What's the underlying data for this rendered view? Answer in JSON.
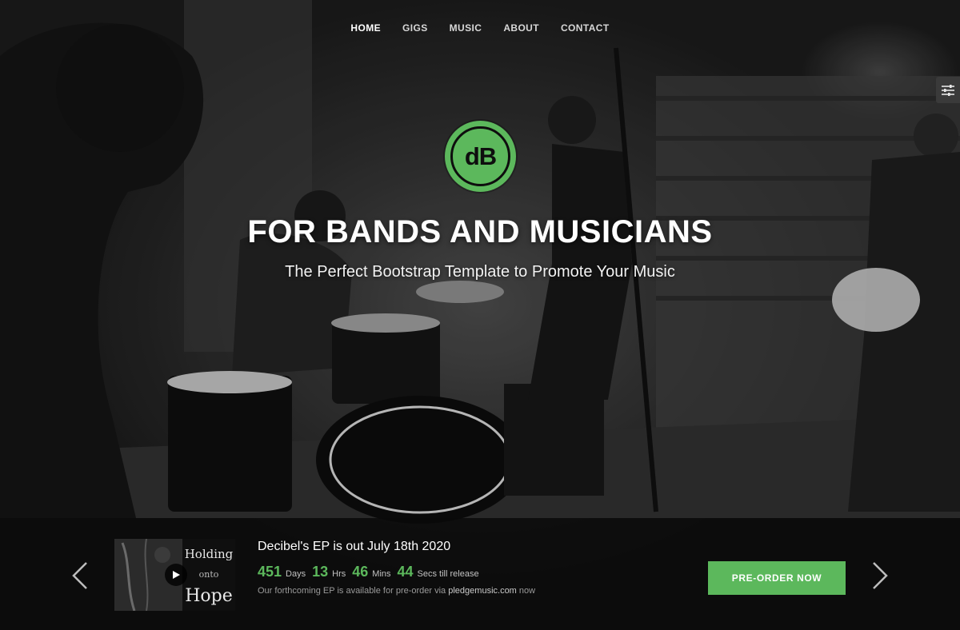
{
  "nav": {
    "items": [
      {
        "label": "HOME",
        "active": true
      },
      {
        "label": "GIGS",
        "active": false
      },
      {
        "label": "MUSIC",
        "active": false
      },
      {
        "label": "ABOUT",
        "active": false
      },
      {
        "label": "CONTACT",
        "active": false
      }
    ]
  },
  "logo": {
    "text": "dB"
  },
  "hero": {
    "title": "FOR BANDS AND MUSICIANS",
    "subtitle": "The Perfect Bootstrap Template to Promote Your Music"
  },
  "release": {
    "title": "Decibel's EP is out July 18th 2020",
    "countdown": {
      "days": "451",
      "days_label": "Days",
      "hours": "13",
      "hours_label": "Hrs",
      "mins": "46",
      "mins_label": "Mins",
      "secs": "44",
      "secs_label": "Secs till release"
    },
    "note_prefix": "Our forthcoming EP is available for pre-order via",
    "note_link": "pledgemusic.com",
    "note_suffix": "now",
    "album_art_text": "Holding onto Hope",
    "cta": "PRE-ORDER NOW"
  },
  "icons": {
    "settings": "sliders-icon",
    "prev": "chevron-left-icon",
    "next": "chevron-right-icon",
    "play": "play-icon"
  },
  "colors": {
    "accent": "#5cb85c",
    "bar_background": "#0a0a0a"
  }
}
